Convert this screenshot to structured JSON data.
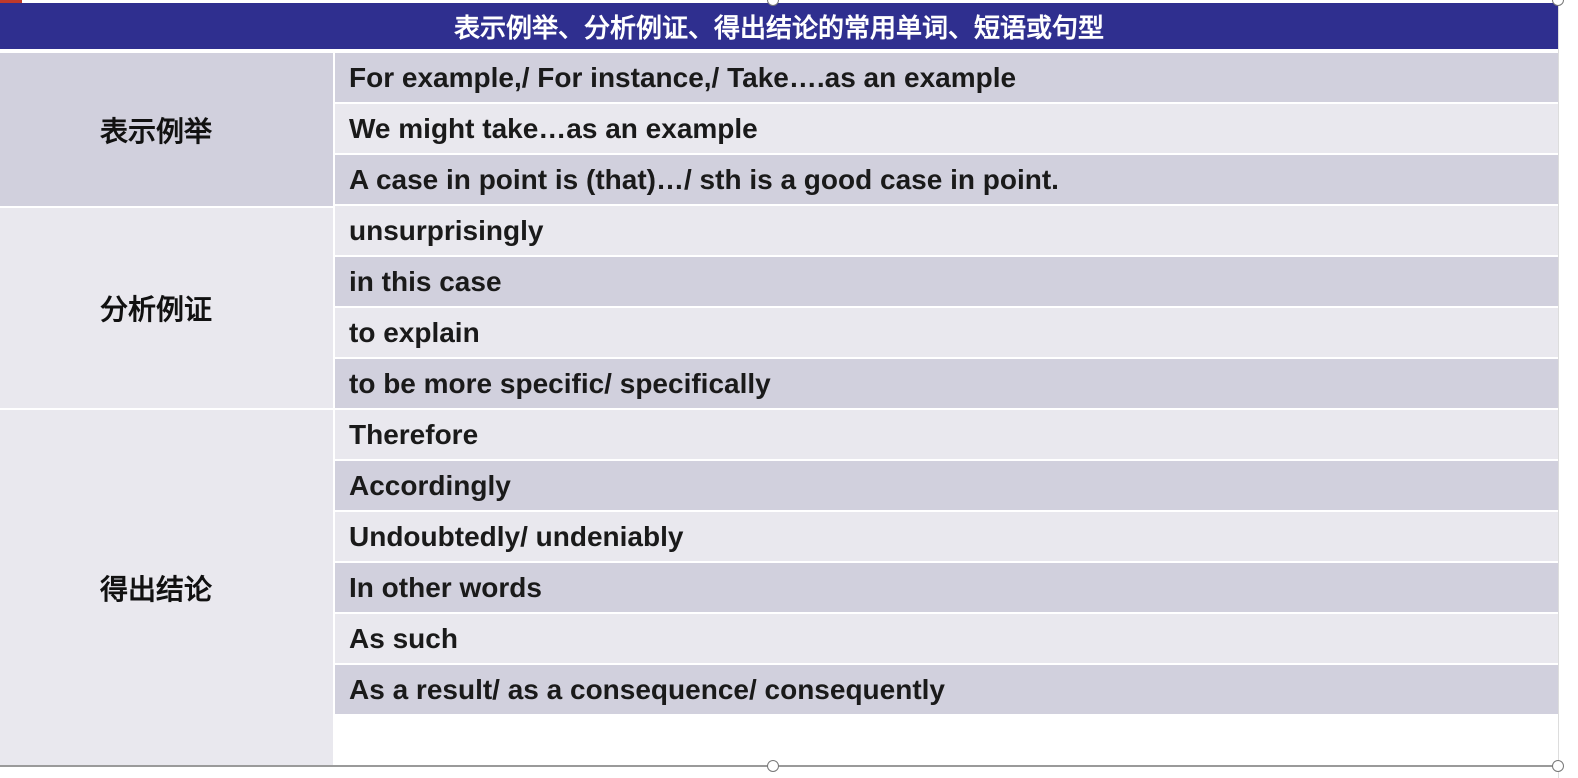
{
  "title": "表示例举、分析例证、得出结论的常用单词、短语或句型",
  "groups": [
    {
      "label": "表示例举",
      "items": [
        "For example,/ For instance,/ Take….as an example",
        "We might take…as an example",
        "A case in point is (that)…/ sth is a good case in point."
      ]
    },
    {
      "label": "分析例证",
      "items": [
        "unsurprisingly",
        "in this case",
        "to explain",
        "to be more specific/ specifically"
      ]
    },
    {
      "label": "得出结论",
      "items": [
        "Therefore",
        "Accordingly",
        "Undoubtedly/ undeniably",
        "In other words",
        "As such",
        "As a result/ as a consequence/ consequently"
      ]
    }
  ],
  "colors": {
    "header_bg": "#2f2f8f",
    "row_dark": "#d1d0dd",
    "row_light": "#e9e8ee"
  }
}
